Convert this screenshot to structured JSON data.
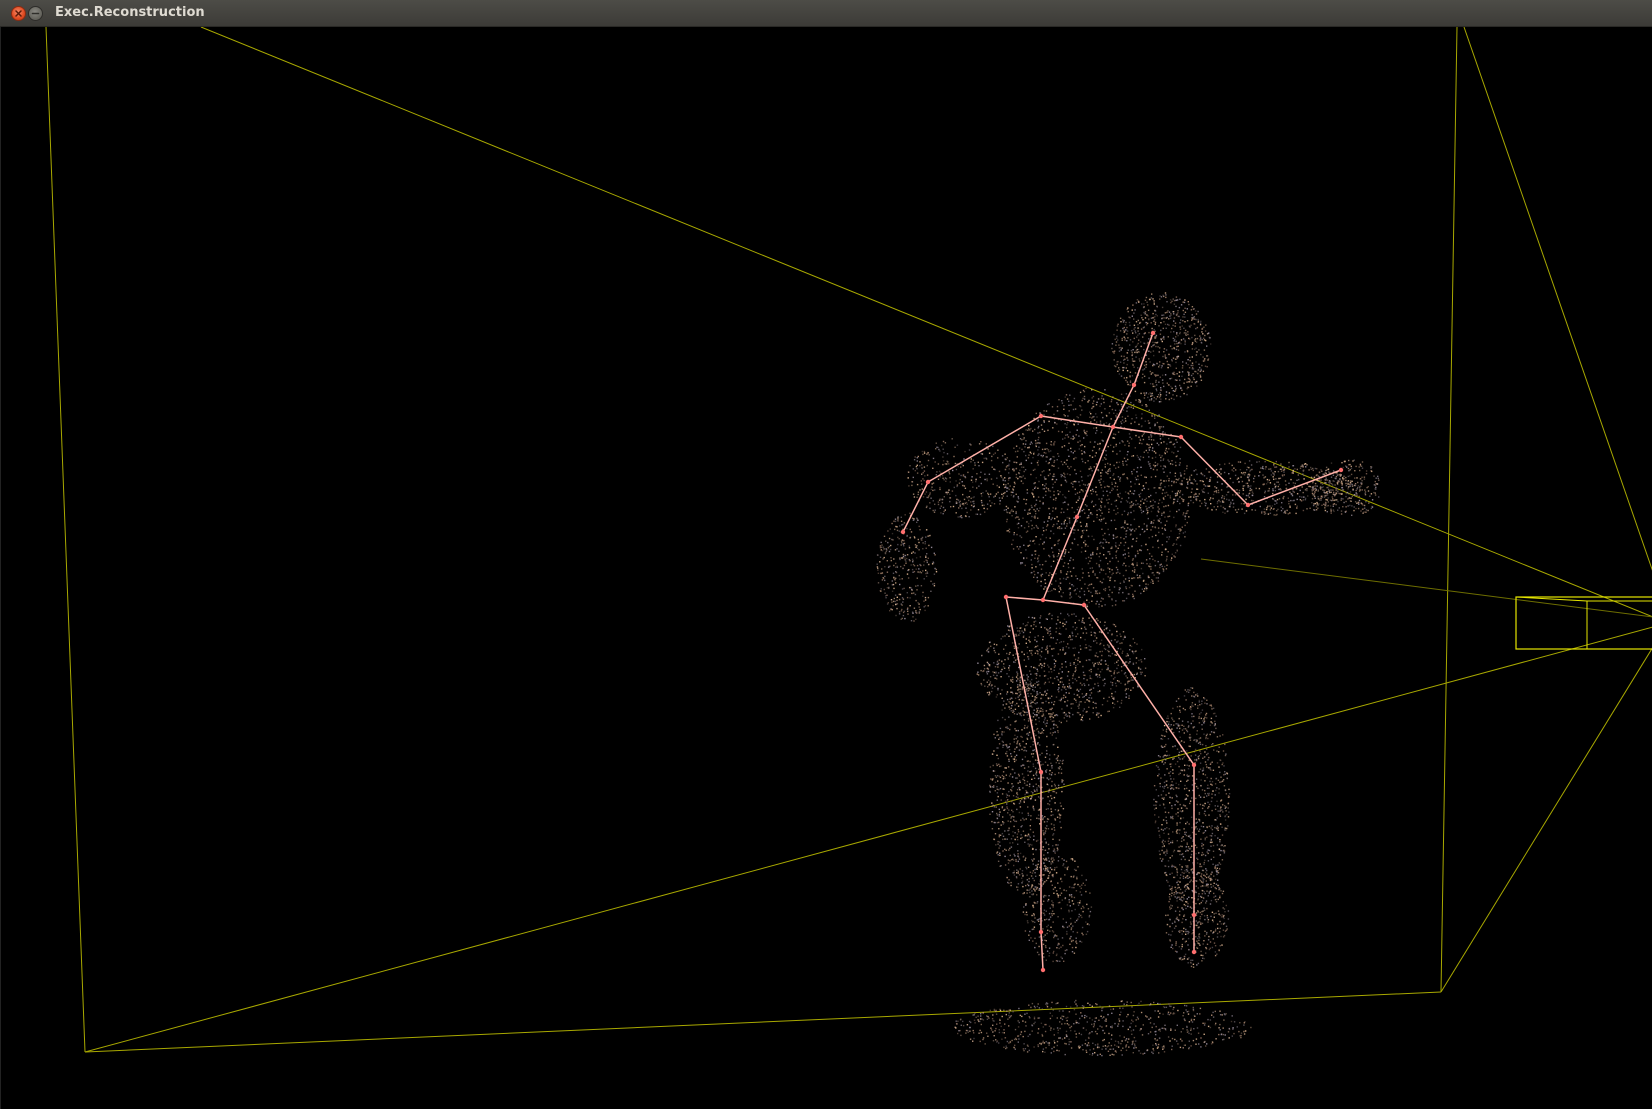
{
  "window": {
    "title": "Exec.Reconstruction",
    "controls": [
      {
        "name": "close-icon",
        "color": "#df4a20"
      },
      {
        "name": "minimize-icon",
        "color": "#67665f"
      }
    ]
  },
  "scene": {
    "background": "#000000",
    "frustum_color": "#b8b800",
    "camera_box_color": "#e6e600",
    "skeleton_color": "#ffb0a8",
    "joint_color": "#ff6e6e",
    "point_cloud_colors": [
      "#8a6a5a",
      "#b08a70",
      "#c9a58a",
      "#7a7078",
      "#9a8e9e",
      "#d8b08c",
      "#6a5a50"
    ]
  }
}
